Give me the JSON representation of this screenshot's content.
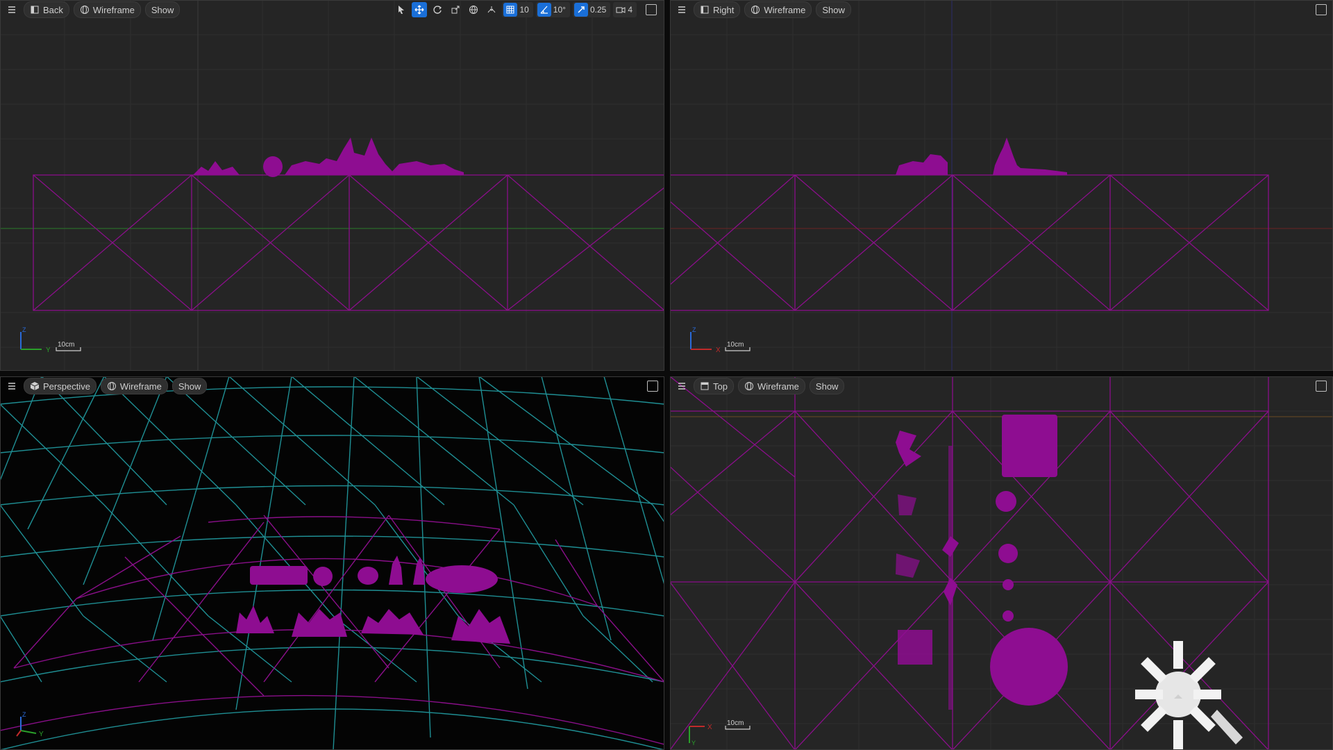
{
  "viewports": {
    "back": {
      "view_label": "Back",
      "mode_label": "Wireframe",
      "show_label": "Show",
      "scale_label": "10cm",
      "axes": [
        "Z",
        "Y"
      ],
      "tools": {
        "grid_snap": "10",
        "rotation_snap": "10°",
        "scale_snap": "0.25",
        "camera_speed": "4"
      }
    },
    "right": {
      "view_label": "Right",
      "mode_label": "Wireframe",
      "show_label": "Show",
      "scale_label": "10cm",
      "axes": [
        "Z",
        "X"
      ]
    },
    "perspective": {
      "view_label": "Perspective",
      "mode_label": "Wireframe",
      "show_label": "Show",
      "axes": [
        "Z",
        "Y"
      ]
    },
    "top": {
      "view_label": "Top",
      "mode_label": "Wireframe",
      "show_label": "Show",
      "scale_label": "10cm",
      "axes": [
        "X",
        "Y"
      ]
    }
  },
  "colors": {
    "wire_magenta": "#8a0f8a",
    "foliage_magenta": "#8e0d91",
    "grid_line": "#2e2e2e",
    "cyan_wire": "#1f8f94",
    "accent_blue": "#1a6fd8",
    "axis_green": "#2a9d2a",
    "axis_red": "#b22a2a"
  },
  "icons": {
    "hamburger": "hamburger-menu-icon",
    "select": "select-arrow-icon",
    "translate": "translate-arrows-icon",
    "rotate": "rotate-icon",
    "scale": "scale-icon",
    "world": "world-globe-icon",
    "surface_snap": "surface-snap-icon",
    "grid": "grid-icon",
    "angle": "angle-icon",
    "scale_snap": "scale-snap-icon",
    "camera": "camera-icon",
    "maximize": "maximize-icon",
    "light": "directional-light-icon"
  }
}
